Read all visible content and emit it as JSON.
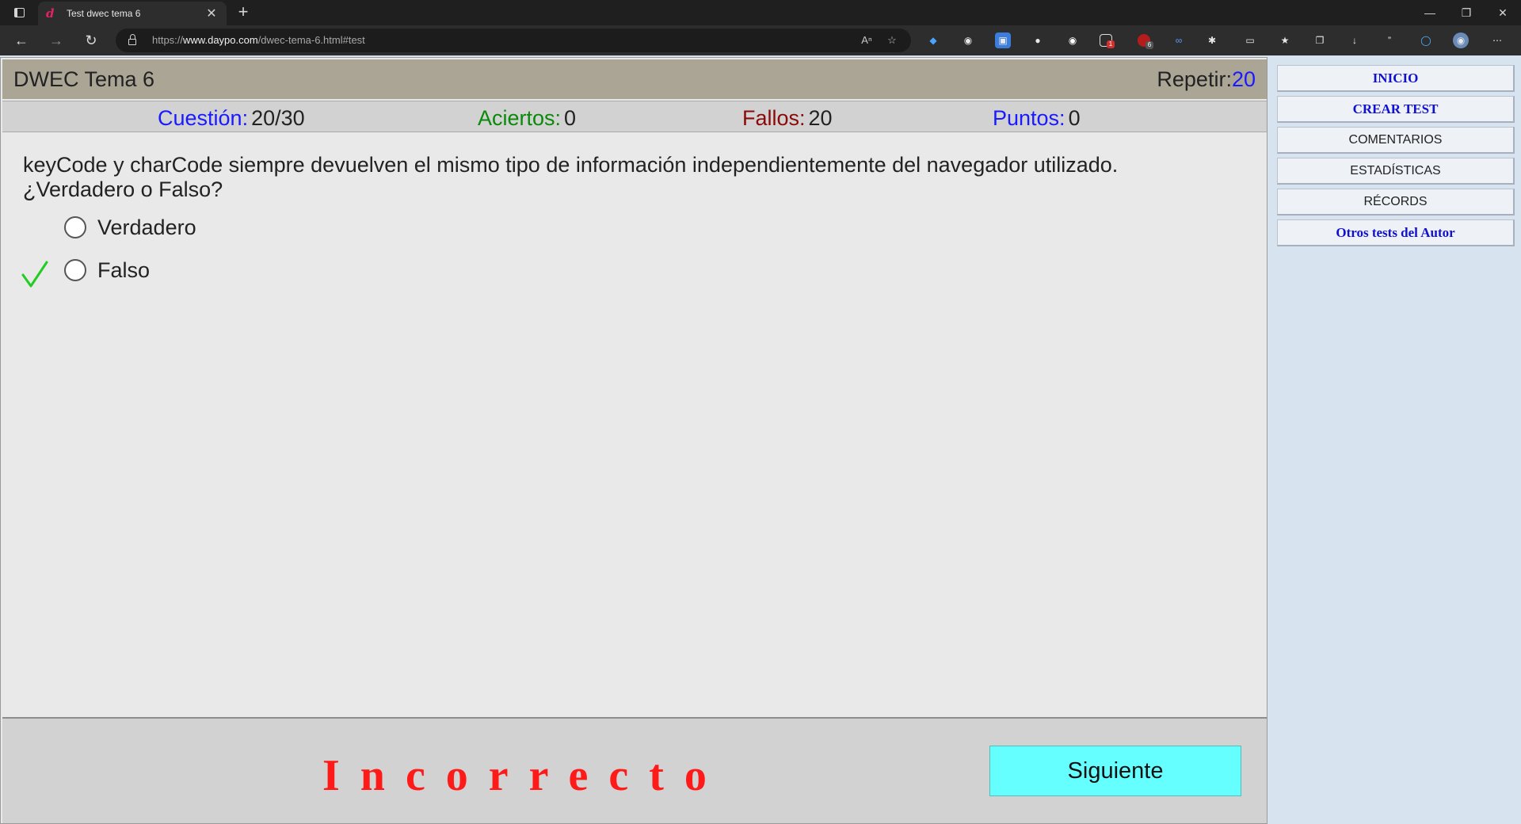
{
  "browser": {
    "tab_title": "Test dwec tema 6",
    "tab_favicon": "d",
    "url_prefix": "https://",
    "url_host": "www.daypo.com",
    "url_path": "/dwec-tema-6.html#test",
    "new_tab": "+",
    "tab_close": "✕",
    "window_controls": {
      "minimize": "—",
      "restore": "❐",
      "close": "✕"
    },
    "extension_badges": {
      "ext5": "1",
      "ext6": "6"
    }
  },
  "quiz": {
    "title": "DWEC Tema 6",
    "repeat_label": "Repetir:",
    "repeat_value": "20",
    "stats": {
      "question_label": "Cuestión:",
      "question_value": "20/30",
      "correct_label": "Aciertos:",
      "correct_value": "0",
      "wrong_label": "Fallos:",
      "wrong_value": "20",
      "points_label": "Puntos:",
      "points_value": "0"
    },
    "colors": {
      "question": "#1a1aff",
      "correct": "#0a8a0a",
      "wrong": "#8a0a0a",
      "points": "#1a1aff"
    },
    "question_line1": "keyCode y charCode siempre devuelven el mismo tipo de información independientemente del navegador utilizado.",
    "question_line2": "¿Verdadero o Falso?",
    "options": [
      {
        "label": "Verdadero",
        "correct": false
      },
      {
        "label": "Falso",
        "correct": true
      }
    ],
    "result_text": "Incorrecto",
    "next_button": "Siguiente"
  },
  "sidebar": {
    "items": [
      {
        "label": "INICIO"
      },
      {
        "label": "CREAR TEST"
      },
      {
        "label": "COMENTARIOS"
      },
      {
        "label": "ESTADÍSTICAS"
      },
      {
        "label": "RÉCORDS"
      },
      {
        "label": "Otros tests del Autor"
      }
    ]
  }
}
